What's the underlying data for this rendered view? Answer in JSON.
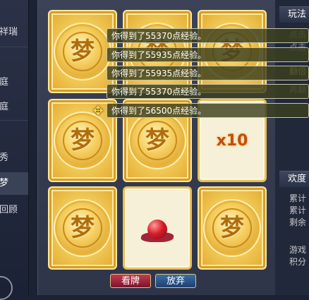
{
  "sidebar": {
    "items": [
      {
        "label": "祥瑞"
      },
      {
        "label": "庭"
      },
      {
        "label": "庭"
      },
      {
        "label": "秀"
      },
      {
        "label": "梦"
      },
      {
        "label": "回顾"
      }
    ]
  },
  "cards": [
    {
      "type": "back",
      "glyph": "梦"
    },
    {
      "type": "back",
      "glyph": "梦"
    },
    {
      "type": "back",
      "glyph": "梦"
    },
    {
      "type": "back",
      "glyph": "梦"
    },
    {
      "type": "back",
      "glyph": "梦"
    },
    {
      "type": "face",
      "label": "x10"
    },
    {
      "type": "back",
      "glyph": "梦"
    },
    {
      "type": "face",
      "label": ""
    },
    {
      "type": "back",
      "glyph": "梦"
    }
  ],
  "messages": [
    "你得到了55370点经验。",
    "你得到了55935点经验。",
    "你得到了55935点经验。",
    "你得到了55370点经验。",
    "你得到了56500点经验。"
  ],
  "buttons": {
    "reveal": "看牌",
    "abandon": "放弃"
  },
  "right_panel": {
    "header1": "玩法",
    "lines1": [
      "点击",
      "点击",
      "翻倍",
      "再翻"
    ],
    "header2": "欢度",
    "lines2": [
      "累计",
      "累计",
      "剩余",
      "游戏",
      "积分"
    ]
  }
}
